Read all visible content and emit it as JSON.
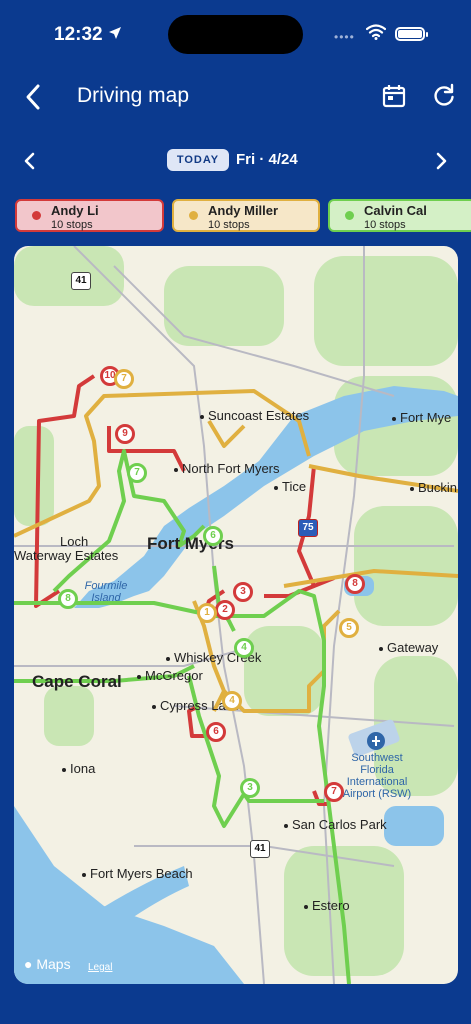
{
  "status_bar": {
    "time": "12:32"
  },
  "header": {
    "title": "Driving map"
  },
  "date_bar": {
    "today_label": "TODAY",
    "date": "Fri · 4/24"
  },
  "drivers": [
    {
      "name": "Andy Li",
      "stops": "10 stops",
      "color": "#d33a3a",
      "bg": "#f2c6cb"
    },
    {
      "name": "Andy Miller",
      "stops": "10 stops",
      "color": "#e0b040",
      "bg": "#f6e7c8"
    },
    {
      "name": "Calvin Cal",
      "stops": "10 stops",
      "color": "#6fcf4f",
      "bg": "#d4f0c6"
    }
  ],
  "map": {
    "places": {
      "suncoast_estates": "Suncoast Estates",
      "fort_myers_ne": "Fort Mye",
      "north_fort_myers": "North Fort Myers",
      "tice": "Tice",
      "buckingham": "Buckin",
      "lochmoor": "Loch",
      "waterway_estates": "Waterway Estates",
      "fort_myers": "Fort Myers",
      "fourmile_island": "Fourmile Island",
      "whiskey_creek": "Whiskey Creek",
      "gateway": "Gateway",
      "cape_coral": "Cape Coral",
      "mcgregor": "McGregor",
      "cypress_lake": "Cypress Lake",
      "airport": "Southwest Florida International Airport (RSW)",
      "iona": "Iona",
      "san_carlos_park": "San Carlos Park",
      "fort_myers_beach": "Fort Myers Beach",
      "estero": "Estero"
    },
    "shields": {
      "us41_north": "41",
      "i75": "75",
      "us41_south": "41"
    },
    "attribution": "Maps",
    "legal": "Legal"
  },
  "pins": {
    "red": [
      "10",
      "9",
      "3",
      "2",
      "8",
      "6",
      "7"
    ],
    "yellow": [
      "7",
      "1",
      "5",
      "4"
    ],
    "green": [
      "7",
      "6",
      "4",
      "3",
      "8"
    ]
  }
}
